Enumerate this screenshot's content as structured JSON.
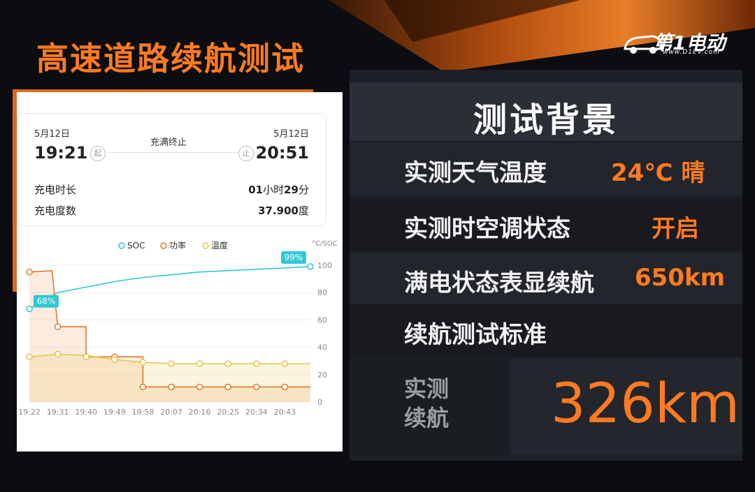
{
  "page_title": "高速道路续航测试",
  "logo": {
    "text": "第1电动",
    "url": "www.D1EV.com"
  },
  "summary": {
    "start_date": "5月12日",
    "start_time": "19:21",
    "end_date": "5月12日",
    "end_time": "20:51",
    "status": "充满终止",
    "start_badge": "起",
    "end_badge": "止",
    "duration_label": "充电时长",
    "duration_h": "01",
    "duration_h_unit": "小时",
    "duration_m": "29",
    "duration_m_unit": "分",
    "energy_label": "充电度数",
    "energy_value": "37.900",
    "energy_unit": "度"
  },
  "colors": {
    "accent": "#ff7a21",
    "soc": "#2ec7d6",
    "power": "#e0792c",
    "temp": "#e8c54a"
  },
  "chart_data": {
    "type": "line",
    "legend": [
      "SOC",
      "功率",
      "温度"
    ],
    "y_unit_label": "°C/SOC",
    "ylim": [
      0,
      100
    ],
    "y_ticks": [
      "100",
      "80",
      "60",
      "40",
      "20",
      "0"
    ],
    "x": [
      "19:22",
      "19:31",
      "19:40",
      "19:49",
      "19:58",
      "20:07",
      "20:16",
      "20:25",
      "20:34",
      "20:43"
    ],
    "soc_start_label": "68%",
    "soc_end_label": "99%",
    "series": [
      {
        "name": "SOC",
        "points": [
          [
            0,
            68
          ],
          [
            0.3,
            72
          ],
          [
            1,
            80
          ],
          [
            2,
            84
          ],
          [
            3,
            88
          ],
          [
            4,
            91
          ],
          [
            5,
            93
          ],
          [
            6,
            95
          ],
          [
            7,
            96
          ],
          [
            8,
            97
          ],
          [
            9,
            98
          ],
          [
            9.9,
            99
          ]
        ]
      },
      {
        "name": "功率",
        "points": [
          [
            0,
            95
          ],
          [
            0.8,
            96
          ],
          [
            1,
            55
          ],
          [
            2,
            55
          ],
          [
            2,
            33
          ],
          [
            3,
            33
          ],
          [
            4,
            33
          ],
          [
            4,
            11
          ],
          [
            5,
            11
          ],
          [
            6,
            11
          ],
          [
            7,
            11
          ],
          [
            8,
            11
          ],
          [
            9,
            11
          ],
          [
            9.9,
            11
          ]
        ]
      },
      {
        "name": "温度",
        "points": [
          [
            0,
            33
          ],
          [
            1,
            35
          ],
          [
            2,
            34
          ],
          [
            3,
            31
          ],
          [
            4,
            29
          ],
          [
            5,
            28
          ],
          [
            6,
            28
          ],
          [
            7,
            28
          ],
          [
            8,
            28
          ],
          [
            9,
            28
          ],
          [
            9.9,
            28
          ]
        ]
      }
    ],
    "markers": {
      "功率": [
        [
          0,
          95
        ],
        [
          1,
          55
        ],
        [
          2,
          33
        ],
        [
          3,
          33
        ],
        [
          4,
          11
        ],
        [
          5,
          11
        ],
        [
          6,
          11
        ],
        [
          7,
          11
        ],
        [
          8,
          11
        ],
        [
          9,
          11
        ]
      ],
      "温度": [
        [
          0,
          33
        ],
        [
          1,
          35
        ],
        [
          2,
          33
        ],
        [
          3,
          31
        ],
        [
          4,
          29
        ],
        [
          5,
          28
        ],
        [
          6,
          28
        ],
        [
          7,
          28
        ],
        [
          8,
          28
        ],
        [
          9,
          28
        ]
      ]
    }
  },
  "info": {
    "header": "测试背景",
    "rows": [
      {
        "label": "实测天气温度",
        "value": "24℃ 晴"
      },
      {
        "label": "实测时空调状态",
        "value": "开启"
      },
      {
        "label": "满电状态表显续航",
        "value": "650km"
      },
      {
        "label": "续航测试标准",
        "value": ""
      }
    ],
    "result_label_1": "实测",
    "result_label_2": "续航",
    "result_value": "326km"
  }
}
